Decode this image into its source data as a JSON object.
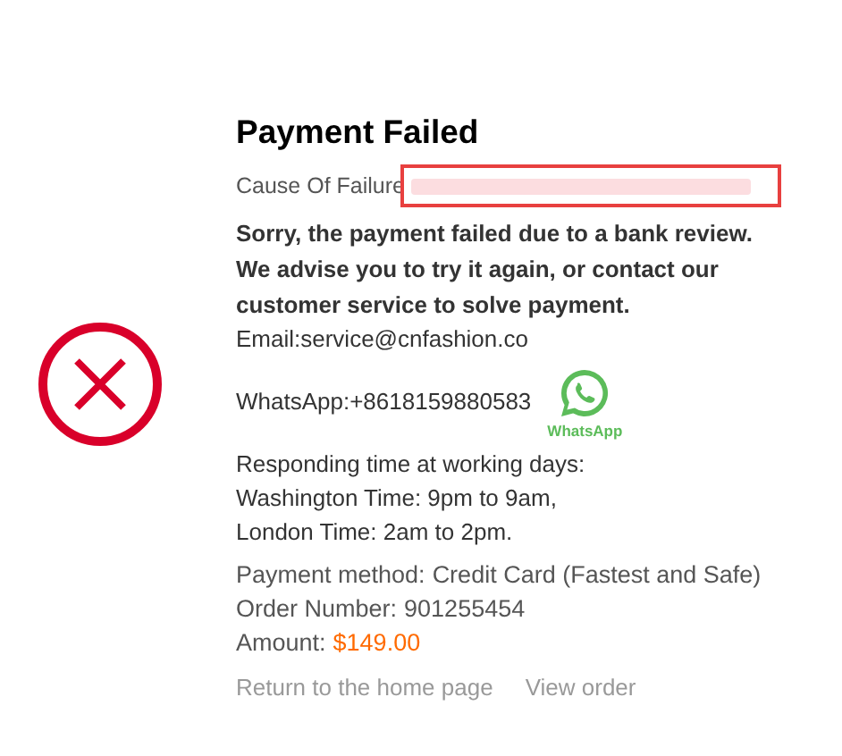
{
  "title": "Payment Failed",
  "cause": {
    "label": "Cause Of Failure"
  },
  "apology": [
    "Sorry, the payment failed due to a bank review.",
    "We advise you to try it again, or contact our customer service to solve payment."
  ],
  "email": "Email:service@cnfashion.co",
  "whatsapp": {
    "text": "WhatsApp:+8618159880583",
    "logo_label": "WhatsApp"
  },
  "hours": [
    "Responding time at working days:",
    "Washington Time: 9pm to 9am,",
    "London Time: 2am to 2pm."
  ],
  "details": [
    {
      "label": "Payment method:",
      "value": "Credit Card (Fastest and Safe)",
      "kind": "plain"
    },
    {
      "label": "Order Number:",
      "value": "901255454",
      "kind": "plain"
    },
    {
      "label": "Amount:",
      "value": "$149.00",
      "kind": "price"
    }
  ],
  "links": [
    "Return to the home page",
    "View order"
  ]
}
